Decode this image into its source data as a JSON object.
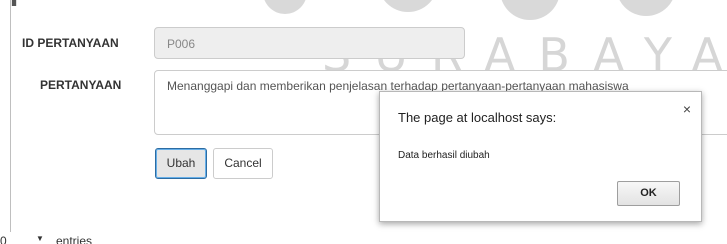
{
  "watermark": {
    "text": "SURABAYA"
  },
  "form": {
    "id_label": "ID PERTANYAAN",
    "id_value": "P006",
    "question_label": "PERTANYAAN",
    "question_value": "Menanggapi dan memberikan penjelasan terhadap pertanyaan-pertanyaan mahasiswa",
    "save_label": "Ubah",
    "cancel_label": "Cancel"
  },
  "table_controls": {
    "entries_value": "0",
    "entries_label": "entries"
  },
  "dialog": {
    "title": "The page at localhost says:",
    "message": "Data berhasil diubah",
    "ok_label": "OK",
    "close_glyph": "×"
  },
  "colors": {
    "primary_border": "#2d6ca2",
    "disabled_field_bg": "#eeeeee"
  }
}
